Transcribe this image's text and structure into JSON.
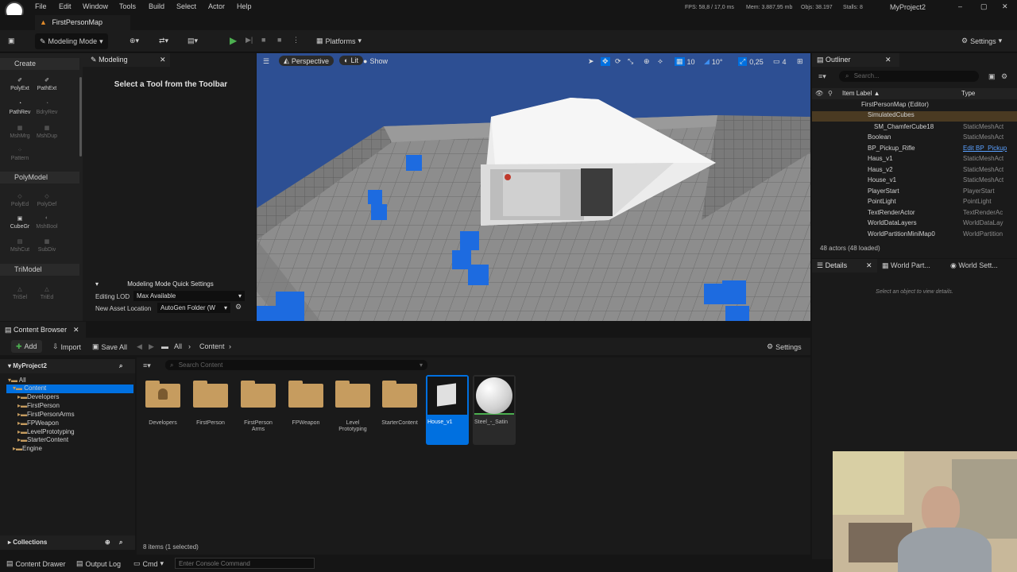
{
  "menu": {
    "items": [
      "File",
      "Edit",
      "Window",
      "Tools",
      "Build",
      "Select",
      "Actor",
      "Help"
    ]
  },
  "stats": {
    "fps": "FPS: 58,8 / 17,0 ms",
    "mem": "Mem: 3.887,95 mb",
    "objs": "Objs: 38.197",
    "stalls": "Stalls: 8"
  },
  "project_name": "MyProject2",
  "level_tab": "FirstPersonMap",
  "toolbar": {
    "mode": "Modeling Mode",
    "platforms": "Platforms",
    "settings": "Settings"
  },
  "left_panel": {
    "tab": "Modeling",
    "sections": [
      {
        "title": "Create",
        "tools": [
          {
            "label": "PolyExt",
            "enabled": true
          },
          {
            "label": "PathExt",
            "enabled": true
          },
          {
            "label": "PathRev",
            "enabled": true
          },
          {
            "label": "BdryRev",
            "enabled": false
          },
          {
            "label": "MshMrg",
            "enabled": false
          },
          {
            "label": "MshDup",
            "enabled": false
          },
          {
            "label": "Pattern",
            "enabled": false
          }
        ]
      },
      {
        "title": "PolyModel",
        "tools": [
          {
            "label": "PolyEd",
            "enabled": false
          },
          {
            "label": "PolyDef",
            "enabled": false
          },
          {
            "label": "CubeGr",
            "enabled": true
          },
          {
            "label": "MshBool",
            "enabled": false
          },
          {
            "label": "MshCut",
            "enabled": false
          },
          {
            "label": "SubDiv",
            "enabled": false
          }
        ]
      },
      {
        "title": "TriModel",
        "tools": [
          {
            "label": "TriSel",
            "enabled": false
          },
          {
            "label": "TriEd",
            "enabled": false
          }
        ]
      }
    ]
  },
  "modeling": {
    "prompt": "Select a Tool from the Toolbar",
    "quick_settings": "Modeling Mode Quick Settings",
    "lod_label": "Editing LOD",
    "lod_value": "Max Available",
    "asset_loc_label": "New Asset Location",
    "asset_loc_value": "AutoGen Folder (W"
  },
  "viewport": {
    "perspective": "Perspective",
    "lit": "Lit",
    "show": "Show",
    "grid": "10",
    "angle": "10°",
    "scale": "0,25",
    "cam_speed": "4"
  },
  "outliner": {
    "tab": "Outliner",
    "search_placeholder": "Search...",
    "col_label": "Item Label ▲",
    "col_type": "Type",
    "rows": [
      {
        "label": "FirstPersonMap (Editor)",
        "type": "",
        "indent": 3
      },
      {
        "label": "SimulatedCubes",
        "type": "",
        "indent": 4
      },
      {
        "label": "SM_ChamferCube18",
        "type": "StaticMeshAct",
        "indent": 5
      },
      {
        "label": "Boolean",
        "type": "StaticMeshAct",
        "indent": 4
      },
      {
        "label": "BP_Pickup_Rifle",
        "type": "Edit BP_Pickup",
        "indent": 4
      },
      {
        "label": "Haus_v1",
        "type": "StaticMeshAct",
        "indent": 4
      },
      {
        "label": "Haus_v2",
        "type": "StaticMeshAct",
        "indent": 4
      },
      {
        "label": "House_v1",
        "type": "StaticMeshAct",
        "indent": 4
      },
      {
        "label": "PlayerStart",
        "type": "PlayerStart",
        "indent": 4
      },
      {
        "label": "PointLight",
        "type": "PointLight",
        "indent": 4
      },
      {
        "label": "TextRenderActor",
        "type": "TextRenderAc",
        "indent": 4
      },
      {
        "label": "WorldDataLayers",
        "type": "WorldDataLay",
        "indent": 4
      },
      {
        "label": "WorldPartitionMiniMap0",
        "type": "WorldPartition",
        "indent": 4
      }
    ],
    "footer": "48 actors (48 loaded)"
  },
  "details": {
    "tabs": [
      "Details",
      "World Part...",
      "World Sett..."
    ],
    "empty": "Select an object to view details."
  },
  "content_browser": {
    "tab": "Content Browser",
    "add": "Add",
    "import": "Import",
    "save_all": "Save All",
    "path": [
      "All",
      "Content"
    ],
    "settings": "Settings",
    "project": "MyProject2",
    "tree": [
      {
        "label": "All",
        "indent": 0
      },
      {
        "label": "Content",
        "indent": 1,
        "selected": true
      },
      {
        "label": "Developers",
        "indent": 2
      },
      {
        "label": "FirstPerson",
        "indent": 2
      },
      {
        "label": "FirstPersonArms",
        "indent": 2
      },
      {
        "label": "FPWeapon",
        "indent": 2
      },
      {
        "label": "LevelPrototyping",
        "indent": 2
      },
      {
        "label": "StarterContent",
        "indent": 2
      },
      {
        "label": "Engine",
        "indent": 1
      }
    ],
    "search_placeholder": "Search Content",
    "assets": [
      {
        "label": "Developers",
        "kind": "folder"
      },
      {
        "label": "FirstPerson",
        "kind": "folder"
      },
      {
        "label": "FirstPerson Arms",
        "kind": "folder"
      },
      {
        "label": "FPWeapon",
        "kind": "folder"
      },
      {
        "label": "Level Prototyping",
        "kind": "folder"
      },
      {
        "label": "StarterContent",
        "kind": "folder"
      },
      {
        "label": "House_v1",
        "kind": "mesh",
        "selected": true
      },
      {
        "label": "Steel_-_Satin",
        "kind": "material"
      }
    ],
    "collections": "Collections",
    "count": "8 items (1 selected)"
  },
  "statusbar": {
    "drawer": "Content Drawer",
    "output": "Output Log",
    "cmd": "Cmd",
    "console_placeholder": "Enter Console Command"
  },
  "colors": {
    "accent": "#0070e0",
    "bg": "#1a1a1a",
    "folder": "#c69c5f",
    "sky": "#2d4f93"
  }
}
